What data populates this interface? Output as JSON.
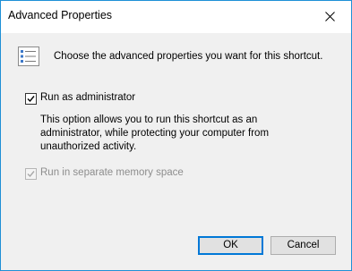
{
  "window": {
    "title": "Advanced Properties",
    "close_icon": "close-icon",
    "border_color": "#1e90d6"
  },
  "header": {
    "icon": "checklist-icon",
    "text": "Choose the advanced properties you want for this shortcut."
  },
  "options": {
    "run_as_admin": {
      "label": "Run as administrator",
      "checked": true,
      "enabled": true,
      "description": "This option allows you to run this shortcut as an administrator, while protecting your computer from unauthorized activity."
    },
    "separate_memory": {
      "label": "Run in separate memory space",
      "checked": true,
      "enabled": false
    }
  },
  "buttons": {
    "ok": "OK",
    "cancel": "Cancel",
    "accent": "#0078d7"
  }
}
